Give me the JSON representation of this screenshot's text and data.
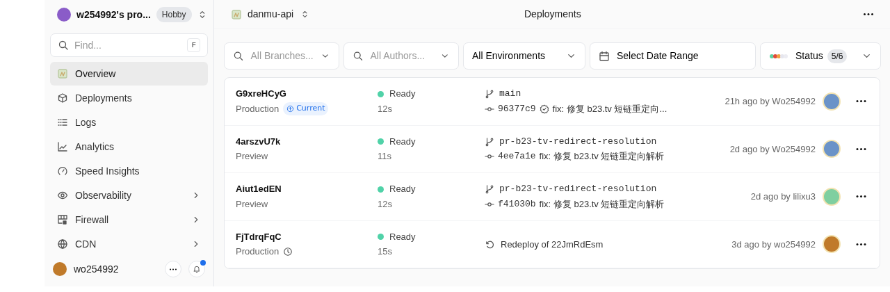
{
  "team": {
    "name": "w254992's pro...",
    "plan": "Hobby"
  },
  "search": {
    "placeholder": "Find...",
    "shortcut": "F"
  },
  "sidebar": {
    "items": [
      {
        "label": "Overview",
        "selected": true,
        "submenu": false
      },
      {
        "label": "Deployments",
        "selected": false,
        "submenu": false
      },
      {
        "label": "Logs",
        "selected": false,
        "submenu": false
      },
      {
        "label": "Analytics",
        "selected": false,
        "submenu": false
      },
      {
        "label": "Speed Insights",
        "selected": false,
        "submenu": false
      },
      {
        "label": "Observability",
        "selected": false,
        "submenu": true
      },
      {
        "label": "Firewall",
        "selected": false,
        "submenu": true
      },
      {
        "label": "CDN",
        "selected": false,
        "submenu": true
      }
    ]
  },
  "user": {
    "name": "wo254992",
    "notification": true
  },
  "header": {
    "project": "danmu-api",
    "title": "Deployments"
  },
  "filters": [
    {
      "kind": "search",
      "placeholder": "All Branches..."
    },
    {
      "kind": "search",
      "placeholder": "All Authors..."
    },
    {
      "kind": "select",
      "label": "All Environments"
    },
    {
      "kind": "date",
      "label": "Select Date Range"
    },
    {
      "kind": "status",
      "label": "Status",
      "count": "5/6"
    }
  ],
  "deployments": [
    {
      "id": "G9xreHCyG",
      "environment": "Production",
      "current": true,
      "current_label": "Current",
      "clock": false,
      "status": "Ready",
      "duration": "12s",
      "source": {
        "kind": "git",
        "branch": "main",
        "commit": "96377c9",
        "verified": true,
        "message": "fix: 修复 b23.tv 短链重定向..."
      },
      "time": "21h ago by Wo254992",
      "color": "#6b93c8"
    },
    {
      "id": "4arszvU7k",
      "environment": "Preview",
      "current": false,
      "clock": false,
      "status": "Ready",
      "duration": "11s",
      "source": {
        "kind": "git",
        "branch": "pr-b23-tv-redirect-resolution",
        "commit": "4ee7a1e",
        "verified": false,
        "message": "fix: 修复 b23.tv 短链重定向解析"
      },
      "time": "2d ago by Wo254992",
      "color": "#6b93c8"
    },
    {
      "id": "Aiut1edEN",
      "environment": "Preview",
      "current": false,
      "clock": false,
      "status": "Ready",
      "duration": "12s",
      "source": {
        "kind": "git",
        "branch": "pr-b23-tv-redirect-resolution",
        "commit": "f41030b",
        "verified": false,
        "message": "fix: 修复 b23.tv 短链重定向解析"
      },
      "time": "2d ago by lilixu3",
      "color": "#7fcfa0"
    },
    {
      "id": "FjTdrqFqC",
      "environment": "Production",
      "current": false,
      "clock": true,
      "status": "Ready",
      "duration": "15s",
      "source": {
        "kind": "redeploy",
        "text": "Redeploy of 22JmRdEsm"
      },
      "time": "3d ago by wo254992",
      "color": "#c07a2a"
    }
  ]
}
